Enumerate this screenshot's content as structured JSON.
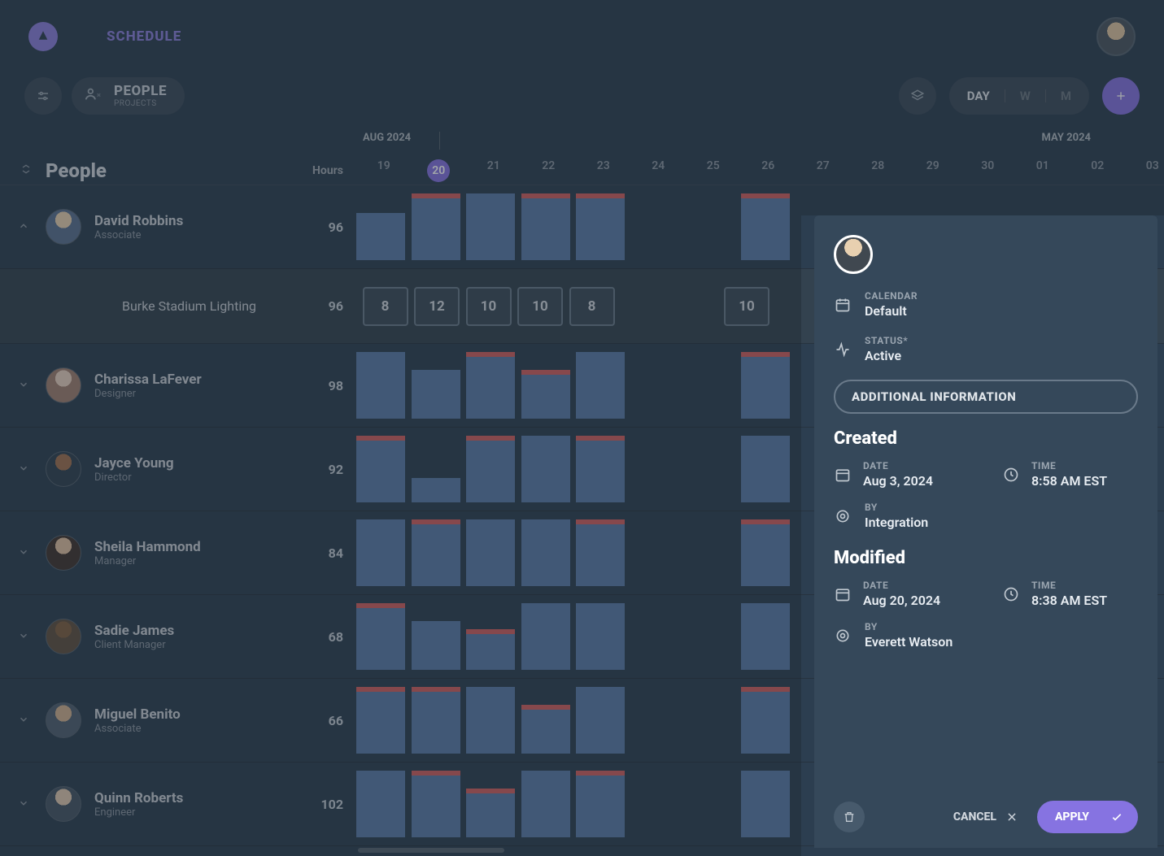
{
  "header": {
    "title": "SCHEDULE"
  },
  "toolbar": {
    "tab_primary": "PEOPLE",
    "tab_secondary": "PROJECTS",
    "view_day": "DAY",
    "view_week": "W",
    "view_month": "M"
  },
  "calendar": {
    "month_left": "AUG 2024",
    "month_right": "MAY 2024",
    "sidebar_title": "People",
    "hours_label": "Hours",
    "days": [
      "19",
      "20",
      "21",
      "22",
      "23",
      "24",
      "25",
      "26",
      "27",
      "28",
      "29",
      "30",
      "01",
      "02",
      "03"
    ],
    "today_index": 1
  },
  "people": [
    {
      "name": "David Robbins",
      "role": "Associate",
      "hours": "96",
      "expanded": true,
      "avatar": "av1"
    },
    {
      "name": "Charissa LaFever",
      "role": "Designer",
      "hours": "98",
      "avatar": "av2"
    },
    {
      "name": "Jayce Young",
      "role": "Director",
      "hours": "92",
      "avatar": "av3"
    },
    {
      "name": "Sheila Hammond",
      "role": "Manager",
      "hours": "84",
      "avatar": "av4"
    },
    {
      "name": "Sadie James",
      "role": "Client Manager",
      "hours": "68",
      "avatar": "av5"
    },
    {
      "name": "Miguel Benito",
      "role": "Associate",
      "hours": "66",
      "avatar": "av6"
    },
    {
      "name": "Quinn Roberts",
      "role": "Engineer",
      "hours": "102",
      "avatar": "av7"
    }
  ],
  "project_row": {
    "name": "Burke Stadium Lighting",
    "hours": "96",
    "cells": [
      "8",
      "12",
      "10",
      "10",
      "8",
      "",
      "",
      "10"
    ]
  },
  "cell_row_template": {
    "row0": [
      1,
      1,
      1,
      1,
      1,
      0,
      0,
      1,
      0
    ],
    "row1": [
      1,
      1,
      1,
      1,
      1,
      0,
      0,
      1,
      0
    ],
    "row2": [
      1,
      1,
      1,
      1,
      1,
      0,
      0,
      1,
      0
    ],
    "row3": [
      1,
      1,
      1,
      1,
      1,
      0,
      0,
      1,
      0
    ],
    "row4": [
      1,
      1,
      1,
      1,
      1,
      0,
      0,
      1,
      0
    ],
    "row5": [
      1,
      1,
      1,
      1,
      1,
      0,
      0,
      1,
      0
    ],
    "row6": [
      1,
      1,
      1,
      1,
      1,
      0,
      0,
      1,
      0
    ]
  },
  "panel": {
    "calendar_label": "CALENDAR",
    "calendar_value": "Default",
    "status_label": "STATUS*",
    "status_value": "Active",
    "additional_label": "ADDITIONAL INFORMATION",
    "created_heading": "Created",
    "modified_heading": "Modified",
    "date_label": "DATE",
    "time_label": "TIME",
    "by_label": "BY",
    "created": {
      "date": "Aug 3, 2024",
      "time": "8:58 AM EST",
      "by": "Integration"
    },
    "modified": {
      "date": "Aug 20, 2024",
      "time": "8:38 AM EST",
      "by": "Everett Watson"
    },
    "cancel": "CANCEL",
    "apply": "APPLY"
  }
}
